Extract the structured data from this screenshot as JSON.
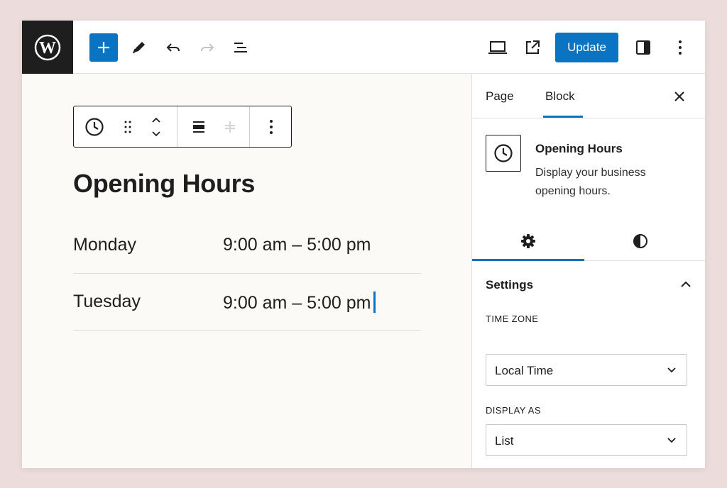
{
  "toolbar": {
    "logo_icon": "wordpress-logo",
    "add_icon": "plus-icon",
    "tools_icon": "pencil-icon",
    "undo_icon": "undo-icon",
    "redo_icon": "redo-icon",
    "outline_icon": "list-view-icon",
    "preview_icon": "laptop-icon",
    "view_icon": "external-link-icon",
    "update_label": "Update",
    "settings_icon": "sidebar-toggle-icon",
    "options_icon": "more-vertical-icon"
  },
  "block_toolbar": {
    "icons": [
      "clock-icon",
      "drag-handle-icon",
      "move-up-down-icon",
      "align-icon",
      "justify-icon",
      "more-vertical-icon"
    ]
  },
  "canvas": {
    "title": "Opening Hours",
    "rows": [
      {
        "day": "Monday",
        "hours": "9:00 am – 5:00 pm"
      },
      {
        "day": "Tuesday",
        "hours": "9:00 am – 5:00 pm"
      }
    ]
  },
  "sidebar": {
    "tabs": [
      "Page",
      "Block"
    ],
    "active_tab": "Block",
    "block_card": {
      "title": "Opening Hours",
      "description": "Display your business opening hours."
    },
    "sub_tabs": [
      "settings-gear-icon",
      "styles-contrast-icon"
    ],
    "panel": {
      "title": "Settings",
      "time_zone_label": "TIME ZONE",
      "time_zone_value": "Local Time",
      "display_as_label": "DISPLAY AS",
      "display_as_value": "List"
    }
  },
  "colors": {
    "accent": "#0a74c3",
    "dark": "#1e1e1e",
    "canvas_bg": "#fcfaf7",
    "page_bg": "#ecdcdc"
  }
}
